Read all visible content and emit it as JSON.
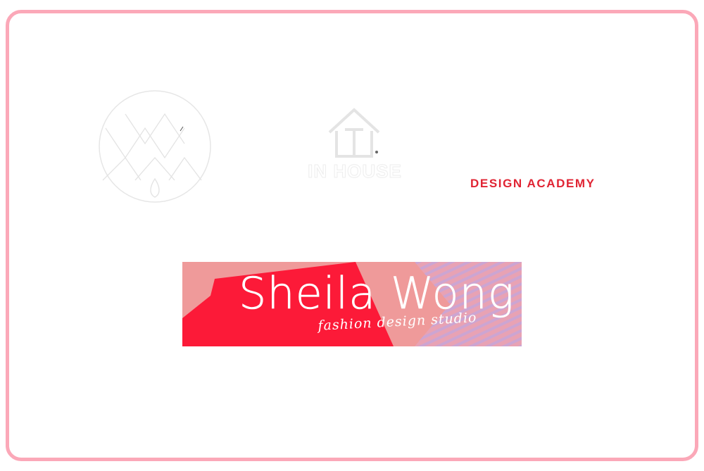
{
  "logos": {
    "circle": {
      "icon": "diamond-monogram-circle-icon"
    },
    "in_house": {
      "icon": "house-icon",
      "text": "IN HOUSE"
    },
    "academy": {
      "text": "DESIGN ACADEMY",
      "color": "#e02433"
    },
    "sheila": {
      "title": "Sheila Wong",
      "subtitle": "fashion design studio",
      "colors": {
        "pink": "#ef9a9a",
        "red": "#fc1a38",
        "stripe": "#c9a5d8"
      }
    }
  },
  "frame": {
    "border_color": "#fba8b8"
  }
}
